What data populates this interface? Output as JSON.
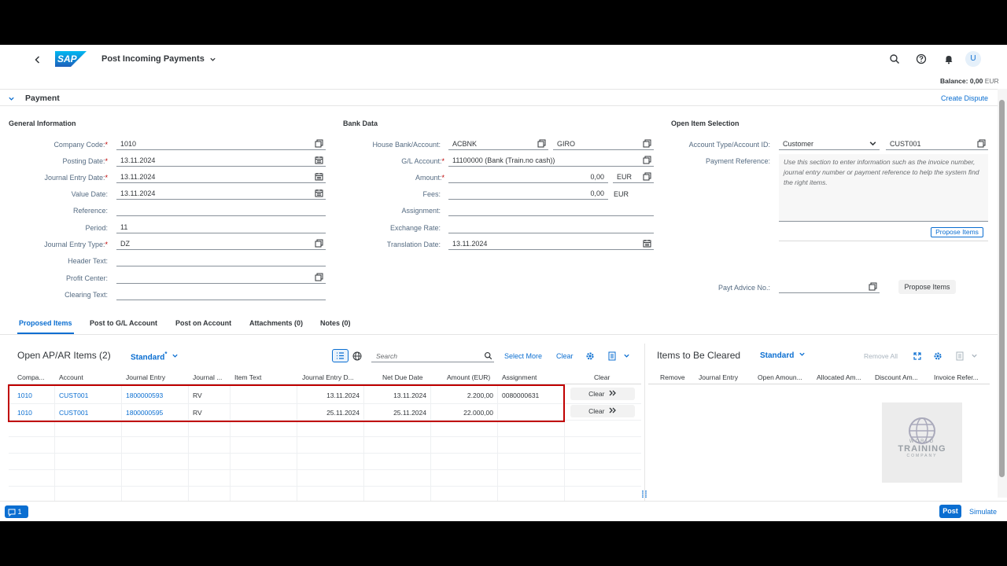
{
  "shell": {
    "title": "Post Incoming Payments",
    "logo_text": "SAP",
    "avatar": "U"
  },
  "balance": {
    "label": "Balance:",
    "value": "0,00",
    "currency": "EUR"
  },
  "payment_section": {
    "title": "Payment",
    "create_dispute": "Create Dispute"
  },
  "general": {
    "title": "General Information",
    "fields": [
      {
        "label": "Company Code:",
        "value": "1010",
        "required": true
      },
      {
        "label": "Posting Date:",
        "value": "13.11.2024",
        "required": true
      },
      {
        "label": "Journal Entry Date:",
        "value": "13.11.2024",
        "required": true
      },
      {
        "label": "Value Date:",
        "value": "13.11.2024",
        "required": false
      },
      {
        "label": "Reference:",
        "value": "",
        "required": false
      },
      {
        "label": "Period:",
        "value": "11",
        "required": false
      },
      {
        "label": "Journal Entry Type:",
        "value": "DZ",
        "required": true
      },
      {
        "label": "Header Text:",
        "value": "",
        "required": false
      },
      {
        "label": "Profit Center:",
        "value": "",
        "required": false
      },
      {
        "label": "Clearing Text:",
        "value": "",
        "required": false
      }
    ]
  },
  "bank": {
    "title": "Bank Data",
    "house_bank_label": "House Bank/Account:",
    "house_bank": "ACBNK",
    "house_account": "GIRO",
    "gl_label": "G/L Account:",
    "gl_value": "11100000 (Bank (Train.no cash))",
    "amount_label": "Amount:",
    "amount_value": "0,00",
    "amount_currency": "EUR",
    "fees_label": "Fees:",
    "fees_value": "0,00",
    "fees_currency": "EUR",
    "assignment_label": "Assignment:",
    "exchange_label": "Exchange Rate:",
    "translation_label": "Translation Date:",
    "translation_value": "13.11.2024"
  },
  "open_item": {
    "title": "Open Item Selection",
    "account_type_label": "Account Type/Account ID:",
    "account_type": "Customer",
    "account_id": "CUST001",
    "payment_ref_label": "Payment Reference:",
    "payment_ref_placeholder": "Use this section to enter information such as the invoice number, journal entry number or payment reference to help the system find the right items.",
    "propose_items": "Propose Items",
    "payt_advice_label": "Payt Advice No.:",
    "propose_items_2": "Propose Items"
  },
  "tabs": [
    "Proposed Items",
    "Post to G/L Account",
    "Post on Account",
    "Attachments (0)",
    "Notes (0)"
  ],
  "open_items_table": {
    "title": "Open AP/AR Items (2)",
    "variant": "Standard",
    "variant_mark": "*",
    "search_placeholder": "Search",
    "select_more": "Select More",
    "clear": "Clear",
    "columns": [
      "Compa...",
      "Account",
      "Journal Entry",
      "Journal ...",
      "Item Text",
      "Journal Entry D...",
      "Net Due Date",
      "Amount (EUR)",
      "Assignment",
      "Clear"
    ],
    "rows": [
      {
        "company": "1010",
        "account": "CUST001",
        "journal_entry": "1800000593",
        "type": "RV",
        "item_text": "",
        "je_date": "13.11.2024",
        "net_due": "13.11.2024",
        "amount": "2.200,00",
        "assignment": "0080000631",
        "clear_label": "Clear"
      },
      {
        "company": "1010",
        "account": "CUST001",
        "journal_entry": "1800000595",
        "type": "RV",
        "item_text": "",
        "je_date": "25.11.2024",
        "net_due": "25.11.2024",
        "amount": "22.000,00",
        "assignment": "",
        "clear_label": "Clear"
      }
    ]
  },
  "cleared_table": {
    "title": "Items to Be Cleared",
    "variant": "Standard",
    "remove_all": "Remove All",
    "columns": [
      "Remove",
      "Journal Entry",
      "Open Amoun...",
      "Allocated Am...",
      "Discount Am...",
      "Invoice Refer..."
    ]
  },
  "watermark": {
    "line1": "WORLD",
    "line2": "TRAINING",
    "line3": "COMPANY"
  },
  "footer": {
    "messages": "1",
    "post": "Post",
    "simulate": "Simulate"
  },
  "colors": {
    "accent": "#0a6ed1",
    "highlight": "#c00000"
  }
}
